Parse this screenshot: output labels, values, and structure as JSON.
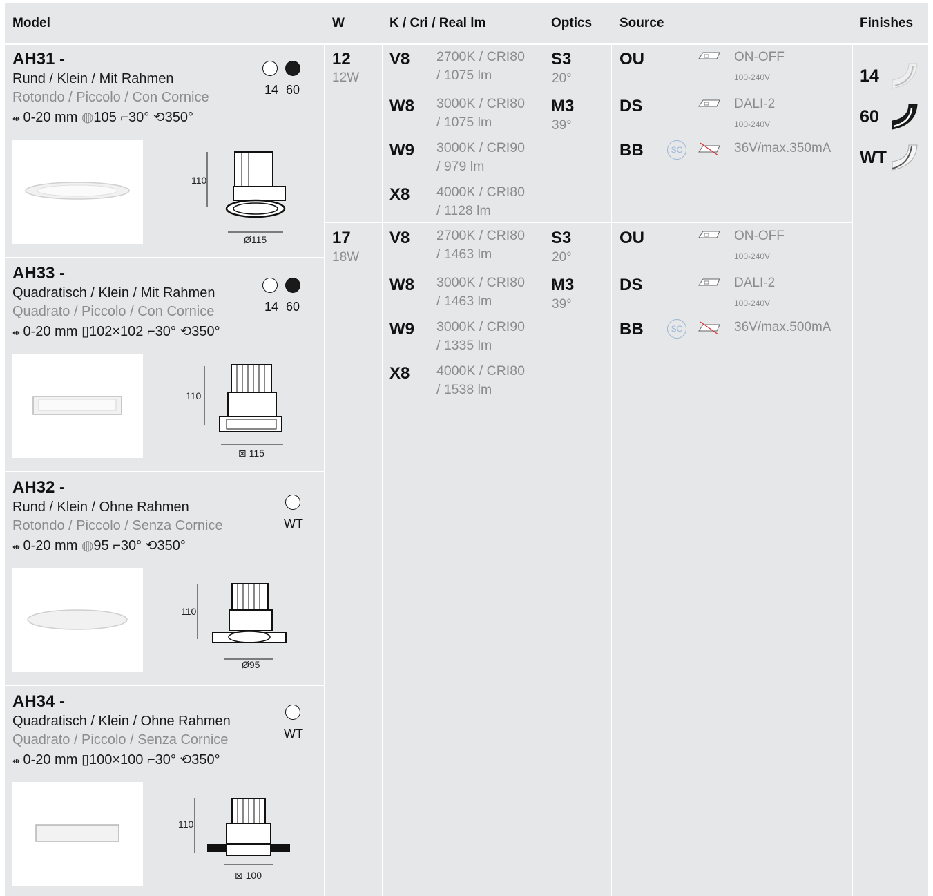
{
  "headers": {
    "model": "Model",
    "w": "W",
    "kcri": "K / Cri / Real lm",
    "optics": "Optics",
    "source": "Source",
    "finishes": "Finishes"
  },
  "models": [
    {
      "code": "AH31 -",
      "de": "Rund / Klein / Mit Rahmen",
      "it": "Rotondo / Piccolo / Con Cornice",
      "spec_range": "0-20 mm",
      "spec_cut": "105",
      "spec_tilt": "30°",
      "spec_rot": "350°",
      "swatches": [
        "14",
        "60"
      ],
      "height": "110",
      "diameter": "Ø115"
    },
    {
      "code": "AH33 -",
      "de": "Quadratisch / Klein / Mit Rahmen",
      "it": "Quadrato / Piccolo / Con Cornice",
      "spec_range": "0-20 mm",
      "spec_cut": "102×102",
      "spec_tilt": "30°",
      "spec_rot": "350°",
      "swatches": [
        "14",
        "60"
      ],
      "height": "110",
      "diameter": "115"
    },
    {
      "code": "AH32 -",
      "de": "Rund / Klein / Ohne Rahmen",
      "it": "Rotondo / Piccolo / Senza Cornice",
      "spec_range": "0-20 mm",
      "spec_cut": "95",
      "spec_tilt": "30°",
      "spec_rot": "350°",
      "swatches": [
        "WT"
      ],
      "height": "110",
      "diameter": "Ø95"
    },
    {
      "code": "AH34 -",
      "de": "Quadratisch / Klein / Ohne Rahmen",
      "it": "Quadrato / Piccolo / Senza Cornice",
      "spec_range": "0-20 mm",
      "spec_cut": "100×100",
      "spec_tilt": "30°",
      "spec_rot": "350°",
      "swatches": [
        "WT"
      ],
      "height": "110",
      "diameter": "100"
    }
  ],
  "power_groups": [
    {
      "w": "12",
      "w_sub": "12W",
      "k_options": [
        {
          "code": "V8",
          "l1": "2700K / CRI80",
          "l2": "/ 1075 lm"
        },
        {
          "code": "W8",
          "l1": "3000K / CRI80",
          "l2": "/ 1075 lm"
        },
        {
          "code": "W9",
          "l1": "3000K / CRI90",
          "l2": "/ 979 lm"
        },
        {
          "code": "X8",
          "l1": "4000K / CRI80",
          "l2": "/ 1128 lm"
        }
      ],
      "optics": [
        {
          "code": "S3",
          "angle": "20°"
        },
        {
          "code": "M3",
          "angle": "39°"
        }
      ],
      "sources": [
        {
          "code": "OU",
          "label": "ON-OFF",
          "volt": "100-240V"
        },
        {
          "code": "DS",
          "label": "DALI-2",
          "volt": "100-240V"
        },
        {
          "code": "BB",
          "label": "36V/max.350mA",
          "volt": "",
          "sc": "SC"
        }
      ]
    },
    {
      "w": "17",
      "w_sub": "18W",
      "k_options": [
        {
          "code": "V8",
          "l1": "2700K / CRI80",
          "l2": "/ 1463 lm"
        },
        {
          "code": "W8",
          "l1": "3000K / CRI80",
          "l2": "/ 1463 lm"
        },
        {
          "code": "W9",
          "l1": "3000K / CRI90",
          "l2": "/ 1335 lm"
        },
        {
          "code": "X8",
          "l1": "4000K / CRI80",
          "l2": "/ 1538 lm"
        }
      ],
      "optics": [
        {
          "code": "S3",
          "angle": "20°"
        },
        {
          "code": "M3",
          "angle": "39°"
        }
      ],
      "sources": [
        {
          "code": "OU",
          "label": "ON-OFF",
          "volt": "100-240V"
        },
        {
          "code": "DS",
          "label": "DALI-2",
          "volt": "100-240V"
        },
        {
          "code": "BB",
          "label": "36V/max.500mA",
          "volt": "",
          "sc": "SC"
        }
      ]
    }
  ],
  "finishes": [
    {
      "code": "14"
    },
    {
      "code": "60"
    },
    {
      "code": "WT"
    }
  ],
  "icons": {
    "range": "adjust-range-icon",
    "cut": "cutout-icon",
    "tilt": "tilt-icon",
    "rot": "rotation-icon",
    "driver": "driver-box-icon",
    "sc": "sc-circle-icon"
  },
  "colors": {
    "panel": "#e6e7e9",
    "gray_text": "#8c8c8c",
    "black_swatch": "#1a1a1a"
  }
}
